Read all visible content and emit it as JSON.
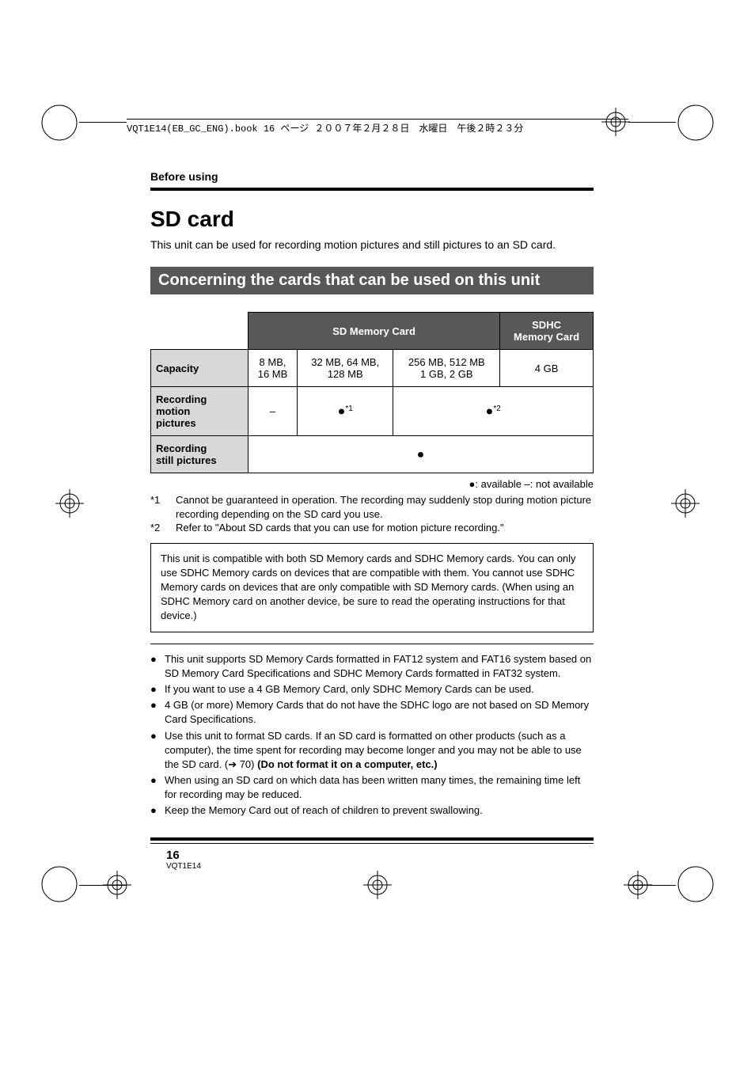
{
  "header_line": "VQT1E14(EB_GC_ENG).book  16 ページ  ２００７年２月２８日　水曜日　午後２時２３分",
  "section_label": "Before using",
  "title": "SD card",
  "intro": "This unit can be used for recording motion pictures and still pictures to an SD card.",
  "banner": "Concerning the cards that can be used on this unit",
  "table": {
    "head_sd": "SD Memory Card",
    "head_sdhc_l1": "SDHC",
    "head_sdhc_l2": "Memory Card",
    "row_capacity": "Capacity",
    "cap_a_l1": "8 MB,",
    "cap_a_l2": "16 MB",
    "cap_b_l1": "32 MB, 64 MB,",
    "cap_b_l2": "128 MB",
    "cap_c_l1": "256 MB, 512 MB",
    "cap_c_l2": "1 GB, 2 GB",
    "cap_d": "4 GB",
    "row_motion_l1": "Recording",
    "row_motion_l2": "motion",
    "row_motion_l3": "pictures",
    "motion_a": "–",
    "motion_b_sup": "*1",
    "motion_cd_sup": "*2",
    "row_still_l1": "Recording",
    "row_still_l2": "still pictures"
  },
  "legend": "●: available   –: not available",
  "footnotes": {
    "f1_label": "*1",
    "f1_text": "Cannot be guaranteed in operation. The recording may suddenly stop during motion picture recording depending on the SD card you use.",
    "f2_label": "*2",
    "f2_text": "Refer to \"About SD cards that you can use for motion picture recording.\""
  },
  "info_box": "This unit is compatible with both SD Memory cards and SDHC Memory cards. You can only use SDHC Memory cards on devices that are compatible with them. You cannot use SDHC Memory cards on devices that are only compatible with SD Memory cards. (When using an SDHC Memory card on another device, be sure to read the operating instructions for that device.)",
  "bullets": {
    "b1": "This unit supports SD Memory Cards formatted in FAT12 system and FAT16 system based on SD Memory Card Specifications and SDHC Memory Cards formatted in FAT32 system.",
    "b2": "If you want to use a 4 GB Memory Card, only SDHC Memory Cards can be used.",
    "b3": "4 GB (or more) Memory Cards that do not have the SDHC logo are not based on SD Memory Card Specifications.",
    "b4_pre": "Use this unit to format SD cards. If an SD card is formatted on other products (such as a computer), the time spent for recording may become longer and you may not be able to use the SD card. (➔ 70) ",
    "b4_bold": "(Do not format it on a computer, etc.)",
    "b5": "When using an SD card on which data has been written many times, the remaining time left for recording may be reduced.",
    "b6": "Keep the Memory Card out of reach of children to prevent swallowing."
  },
  "footer": {
    "page": "16",
    "code": "VQT1E14"
  }
}
